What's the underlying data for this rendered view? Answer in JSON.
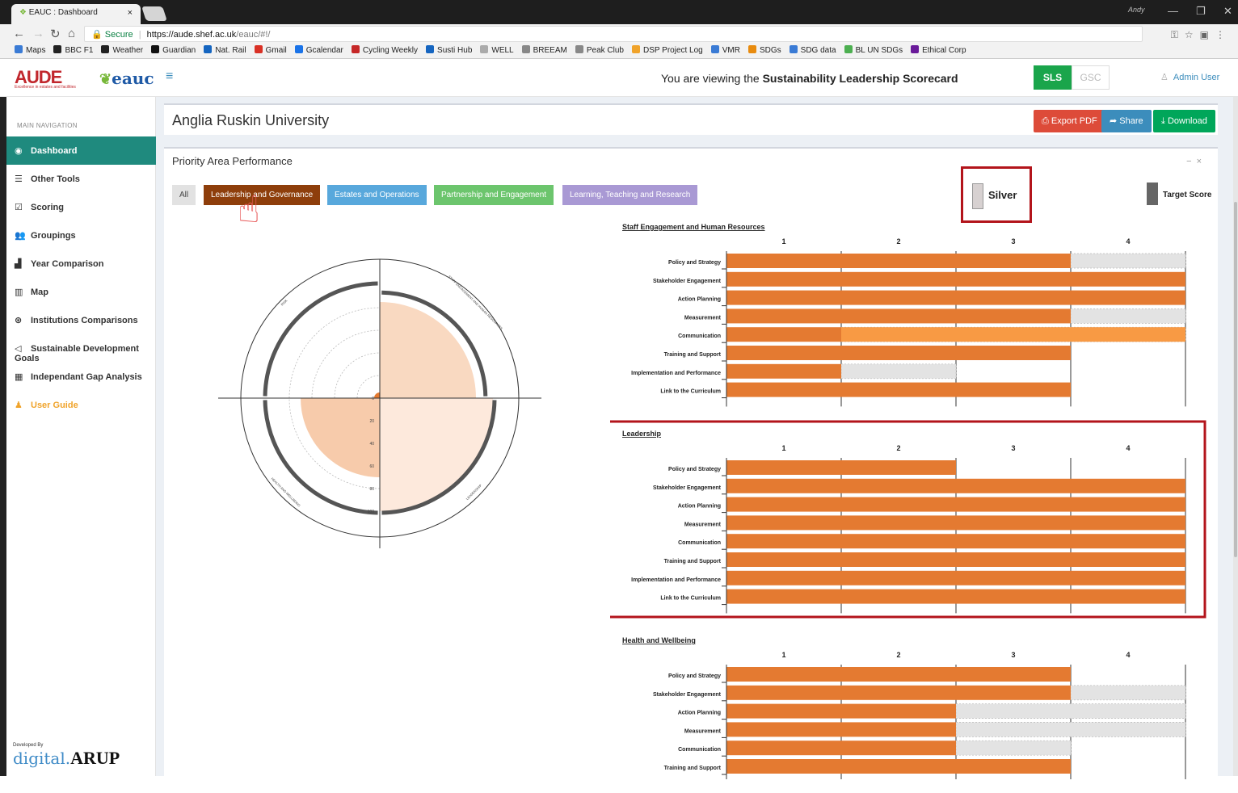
{
  "browser": {
    "tab_title": "EAUC : Dashboard",
    "tab_close": "×",
    "profile": "Andy",
    "secure_label": "Secure",
    "url_domain": "https://aude.shef.ac.uk",
    "url_path": "/eauc/#!/",
    "bookmarks": [
      "Maps",
      "BBC F1",
      "Weather",
      "Guardian",
      "Nat. Rail",
      "Gmail",
      "Gcalendar",
      "Cycling Weekly",
      "Susti Hub",
      "WELL",
      "BREEAM",
      "Peak Club",
      "DSP Project Log",
      "VMR",
      "SDGs",
      "SDG data",
      "BL UN SDGs",
      "Ethical Corp"
    ]
  },
  "header": {
    "logo_aude": "AUDE",
    "logo_aude_tag": "Excellence in estates and facilities",
    "logo_eauc": "eauc",
    "viewing_prefix": "You are viewing the ",
    "viewing_bold": "Sustainability Leadership Scorecard",
    "btn_sls": "SLS",
    "btn_gsc": "GSC",
    "admin_user": "Admin User"
  },
  "sidebar": {
    "header": "MAIN NAVIGATION",
    "items": [
      {
        "label": "Dashboard",
        "icon": "◉"
      },
      {
        "label": "Other Tools",
        "icon": "☰"
      },
      {
        "label": "Scoring",
        "icon": "☑"
      },
      {
        "label": "Groupings",
        "icon": "👥"
      },
      {
        "label": "Year Comparison",
        "icon": "▟"
      },
      {
        "label": "Map",
        "icon": "▥"
      },
      {
        "label": "Institutions Comparisons",
        "icon": "⊛"
      },
      {
        "label": "Sustainable Development Goals",
        "icon": "◁"
      },
      {
        "label": "Independant Gap Analysis",
        "icon": "▦"
      },
      {
        "label": "User Guide",
        "icon": "♟"
      }
    ],
    "developed_by": "Developed By",
    "brand_digital": "digital",
    "brand_arup": "ARUP"
  },
  "page": {
    "institution": "Anglia Ruskin University",
    "export_pdf": "Export PDF",
    "share": "Share",
    "download": "Download",
    "panel_title": "Priority Area Performance",
    "filters": {
      "all": "All",
      "leadership": "Leadership and Governance",
      "estates": "Estates and Operations",
      "partnership": "Partnership and Engagement",
      "learning": "Learning, Teaching and Research"
    },
    "legend_silver": "Silver",
    "legend_target": "Target Score"
  },
  "colors": {
    "bar": "#e47a31",
    "bar_light": "#f89a44",
    "target_fill": "#e3e3e3",
    "accent_red": "#b3141b"
  },
  "chart_data": [
    {
      "type": "pie",
      "title": "",
      "segment_labels": [
        "STAFF ENGAGEMENT AND HUMAN RESOURCES",
        "LEADERSHIP",
        "HEALTH AND WELLBEING",
        "RISK"
      ],
      "values": [
        85,
        100,
        70,
        5
      ],
      "target_values": [
        92,
        100,
        100,
        100
      ],
      "radial_ticks": [
        "0",
        "20",
        "40",
        "60",
        "80",
        "100"
      ],
      "range": [
        0,
        100
      ]
    },
    {
      "type": "bar",
      "orientation": "horizontal",
      "title": "Staff Engagement and Human Resources",
      "x_ticks": [
        "1",
        "2",
        "3",
        "4"
      ],
      "xlim": [
        0,
        4
      ],
      "categories": [
        "Policy and Strategy",
        "Stakeholder Engagement",
        "Action Planning",
        "Measurement",
        "Communication",
        "Training and Support",
        "Implementation and Performance",
        "Link to the Curriculum"
      ],
      "values": [
        3,
        4,
        4,
        3,
        1,
        3,
        1,
        3
      ],
      "target_values": [
        4,
        4,
        4,
        4,
        4,
        3,
        2,
        3
      ],
      "highlight_categories": [
        "Communication"
      ]
    },
    {
      "type": "bar",
      "orientation": "horizontal",
      "title": "Leadership",
      "x_ticks": [
        "1",
        "2",
        "3",
        "4"
      ],
      "xlim": [
        0,
        4
      ],
      "categories": [
        "Policy and Strategy",
        "Stakeholder Engagement",
        "Action Planning",
        "Measurement",
        "Communication",
        "Training and Support",
        "Implementation and Performance",
        "Link to the Curriculum"
      ],
      "values": [
        2,
        4,
        4,
        4,
        4,
        4,
        4,
        4
      ],
      "target_values": [
        2,
        4,
        4,
        4,
        4,
        4,
        4,
        4
      ],
      "highlight_categories": []
    },
    {
      "type": "bar",
      "orientation": "horizontal",
      "title": "Health and Wellbeing",
      "x_ticks": [
        "1",
        "2",
        "3",
        "4"
      ],
      "xlim": [
        0,
        4
      ],
      "categories": [
        "Policy and Strategy",
        "Stakeholder Engagement",
        "Action Planning",
        "Measurement",
        "Communication",
        "Training and Support"
      ],
      "values": [
        3,
        3,
        2,
        2,
        2,
        3
      ],
      "target_values": [
        3,
        4,
        4,
        4,
        3,
        3
      ],
      "highlight_categories": []
    }
  ]
}
